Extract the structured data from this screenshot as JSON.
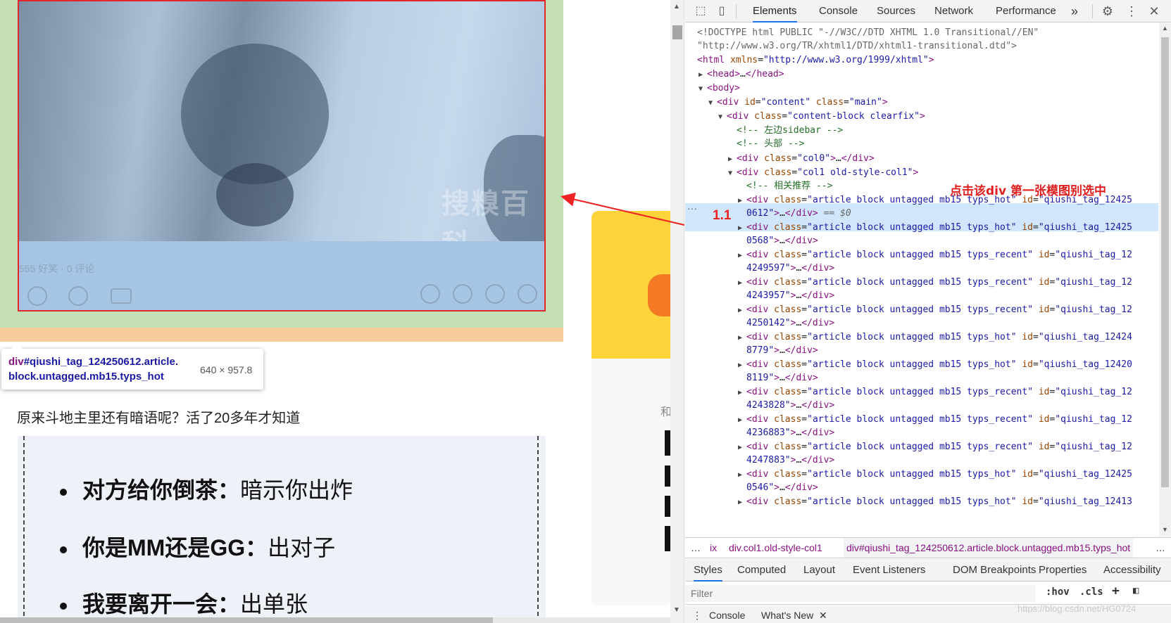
{
  "page": {
    "post_stats": "555 好笑 · 0 评论",
    "watermark": "搜糗百科",
    "tooltip": {
      "tag": "div",
      "selector": "#qiushi_tag_124250612.article.",
      "selector2": "block.untagged.mb15.typs_hot",
      "size": "640 × 957.8"
    },
    "article_title": "原来斗地主里还有暗语呢？活了20多年才知道",
    "article_image_lines": [
      {
        "bold": "对方给你倒茶：",
        "rest": "暗示你出炸"
      },
      {
        "bold": "你是MM还是GG：",
        "rest": "出对子"
      },
      {
        "bold": "我要离开一会：",
        "rest": "出单张"
      }
    ],
    "sidebar_text": "和"
  },
  "annotation": {
    "label": "1.1",
    "note": "点击该div  第一张模图别选中"
  },
  "devtools": {
    "tabs": [
      "Elements",
      "Console",
      "Sources",
      "Network",
      "Performance"
    ],
    "more": "»",
    "doctype1": "<!DOCTYPE html PUBLIC \"-//W3C//DTD XHTML 1.0 Transitional//EN\"",
    "doctype2": "\"http://www.w3.org/TR/xhtml1/DTD/xhtml1-transitional.dtd\">",
    "html_xmlns": "http://www.w3.org/1999/xhtml",
    "comment_sidebar": "<!-- 左边sidebar -->",
    "comment_head": "<!-- 头部 -->",
    "comment_related": "<!-- 相关推荐 -->",
    "selected_marker": "== $0",
    "articles": [
      {
        "cls": "article block untagged mb15 typs_hot",
        "id1": "qiushi_tag_12425",
        "id2": "0612"
      },
      {
        "cls": "article block untagged mb15 typs_hot",
        "id1": "qiushi_tag_12425",
        "id2": "0568"
      },
      {
        "cls": "article block untagged mb15 typs_recent",
        "id1": "qiushi_tag_12",
        "id2": "4249597"
      },
      {
        "cls": "article block untagged mb15 typs_recent",
        "id1": "qiushi_tag_12",
        "id2": "4243957"
      },
      {
        "cls": "article block untagged mb15 typs_recent",
        "id1": "qiushi_tag_12",
        "id2": "4250142"
      },
      {
        "cls": "article block untagged mb15 typs_hot",
        "id1": "qiushi_tag_12424",
        "id2": "8779"
      },
      {
        "cls": "article block untagged mb15 typs_hot",
        "id1": "qiushi_tag_12420",
        "id2": "8119"
      },
      {
        "cls": "article block untagged mb15 typs_recent",
        "id1": "qiushi_tag_12",
        "id2": "4243828"
      },
      {
        "cls": "article block untagged mb15 typs_recent",
        "id1": "qiushi_tag_12",
        "id2": "4236883"
      },
      {
        "cls": "article block untagged mb15 typs_recent",
        "id1": "qiushi_tag_12",
        "id2": "4247883"
      },
      {
        "cls": "article block untagged mb15 typs_hot",
        "id1": "qiushi_tag_12425",
        "id2": "0546"
      },
      {
        "cls": "article block untagged mb15 typs_hot",
        "id1": "qiushi_tag_12413",
        "id2": ""
      }
    ],
    "breadcrumbs": {
      "ellipsis": "…",
      "ix": "ix",
      "col1": "div.col1.old-style-col1",
      "selected": "div#qiushi_tag_124250612.article.block.untagged.mb15.typs_hot",
      "more": "…"
    },
    "style_tabs": [
      "Styles",
      "Computed",
      "Layout",
      "Event Listeners",
      "DOM Breakpoints",
      "Properties",
      "Accessibility"
    ],
    "filter_placeholder": "Filter",
    "hov": ":hov",
    "cls": ".cls",
    "drawer_tabs": [
      "Console",
      "What's New"
    ],
    "csdn_watermark": "https://blog.csdn.net/HG0724"
  }
}
